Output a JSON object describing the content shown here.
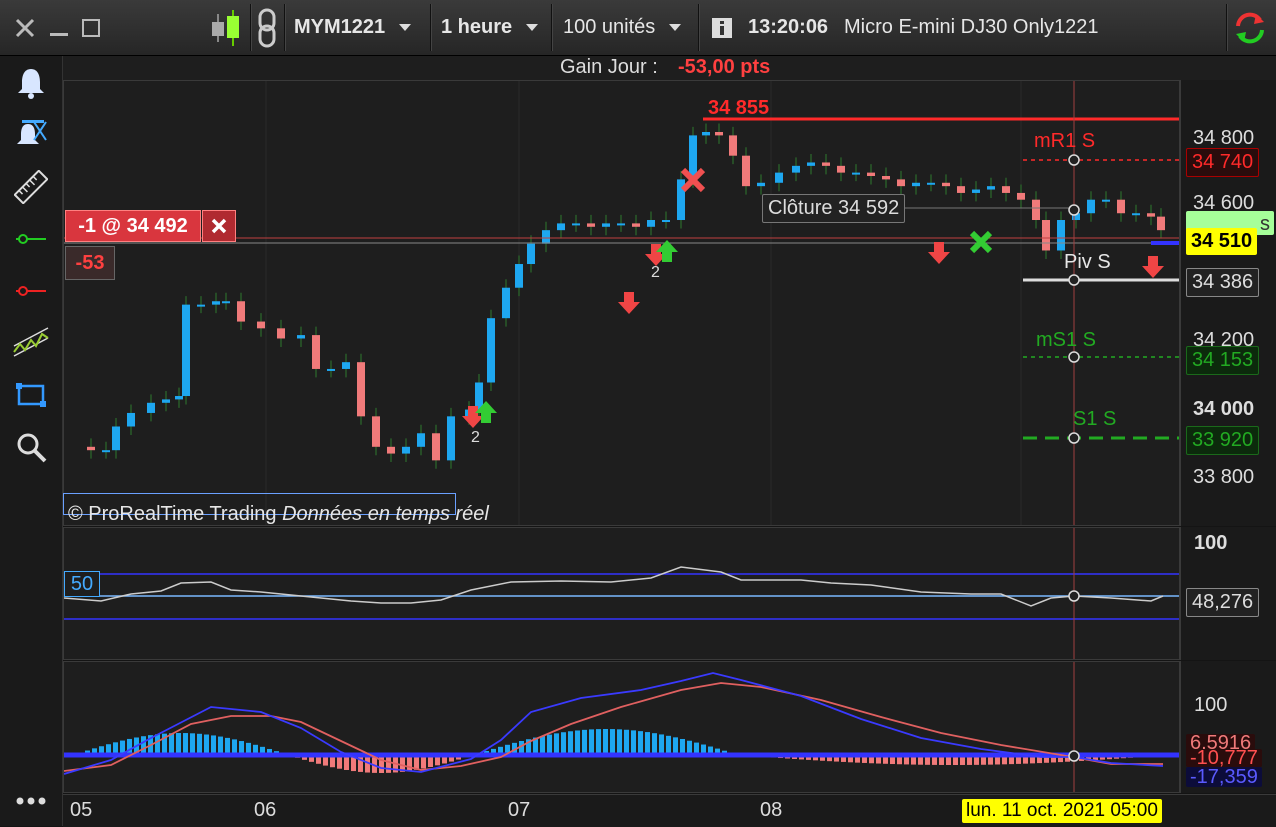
{
  "toolbar": {
    "symbol": "MYM1221",
    "timeframe": "1 heure",
    "units": "100 unités",
    "time": "13:20:06",
    "instrument": "Micro E-mini DJ30 Only1221"
  },
  "header": {
    "gain_label": "Gain Jour :",
    "gain_value": "-53,00 pts"
  },
  "position": {
    "label": "-1 @ 34 492",
    "pnl": "-53"
  },
  "price_chart": {
    "high_label": "34 855",
    "close_label": "Clôture",
    "close_value": "34 592",
    "pivots": [
      {
        "name": "mR1 S",
        "value": "34 740",
        "color": "#ff2a2a"
      },
      {
        "name": "Piv S",
        "value": "34 386",
        "color": "#e6e6e6"
      },
      {
        "name": "mS1 S",
        "value": "34 153",
        "color": "#22aa22"
      },
      {
        "name": "S1 S",
        "value": "33 920",
        "color": "#22aa22"
      }
    ],
    "axis_ticks": [
      "34 800",
      "34 600",
      "34 200",
      "34 000",
      "33 800"
    ],
    "current_price": "34 510",
    "side_partial": "s",
    "marker_count_1": "2",
    "marker_count_2": "2",
    "copyright": "© ProRealTime Trading",
    "realtime": "Données en temps réel"
  },
  "oscillator": {
    "level_label": "50",
    "axis_top": "100",
    "value": "48,276"
  },
  "macd": {
    "axis_top": "100",
    "values": [
      "6,5916",
      "-10,777",
      "-17,359"
    ]
  },
  "x_axis": {
    "labels": [
      "05",
      "06",
      "07",
      "08"
    ],
    "cursor_label": "lun. 11 oct. 2021 05:00"
  },
  "colors": {
    "up": "#1ea7f0",
    "down": "#f07a7a",
    "red": "#ff2a2a",
    "green": "#22aa22",
    "blue": "#3333ff",
    "yellow": "#ffff00"
  }
}
